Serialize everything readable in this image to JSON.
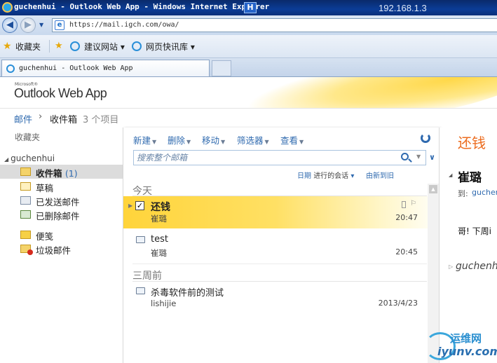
{
  "window": {
    "title": "guchenhui - Outlook Web App - Windows Internet Explorer",
    "badge": "H",
    "ip_address": "192.168.1.3"
  },
  "address_bar": {
    "url": "https://mail.igch.com/owa/"
  },
  "favorites_bar": {
    "favorites_label": "收藏夹",
    "suggested_sites": "建议网站",
    "web_slice_gallery": "网页快讯库"
  },
  "tab": {
    "title": "guchenhui - Outlook Web App"
  },
  "owa": {
    "microsoft_label": "Microsoft®",
    "logo": "Outlook Web App"
  },
  "breadcrumb": {
    "mail": "邮件",
    "separator": "›",
    "inbox": "收件箱",
    "item_count": "3 个项目"
  },
  "folder_pane": {
    "favorites": "收藏夹",
    "account": "guchenhui",
    "folders": [
      {
        "label": "收件箱",
        "count": "(1)",
        "icon": "inbox-icon"
      },
      {
        "label": "草稿",
        "count": "",
        "icon": "drafts-icon"
      },
      {
        "label": "已发送邮件",
        "count": "",
        "icon": "sent-items-icon"
      },
      {
        "label": "已删除邮件",
        "count": "",
        "icon": "deleted-items-icon"
      },
      {
        "label": "便笺",
        "count": "",
        "icon": "notes-icon"
      },
      {
        "label": "垃圾邮件",
        "count": "",
        "icon": "junk-mail-icon"
      }
    ]
  },
  "toolbar": {
    "new": "新建",
    "delete": "删除",
    "move": "移动",
    "filter": "筛选器",
    "view": "查看"
  },
  "search": {
    "placeholder": "搜索整个邮箱"
  },
  "sort": {
    "date": "日期",
    "conversation": "进行的会话",
    "order": "由新到旧"
  },
  "message_list": {
    "groups": [
      {
        "header": "今天",
        "items": [
          {
            "subject": "还钱",
            "sender": "崔璐",
            "time": "20:47",
            "selected": true
          },
          {
            "subject": "test",
            "sender": "崔璐",
            "time": "20:45",
            "selected": false
          }
        ]
      },
      {
        "header": "三周前",
        "items": [
          {
            "subject": "杀毒软件前的测试",
            "sender": "lishijie",
            "time": "2013/4/23",
            "selected": false
          }
        ]
      }
    ]
  },
  "reading_pane": {
    "subject": "还钱",
    "from": "崔璐",
    "to_label": "到:",
    "to_value": "gucher",
    "body": "哥! 下周i",
    "thread": "guchenh"
  },
  "watermark": {
    "text_cn": "运维网",
    "text_url": "iyunv.com"
  },
  "colors": {
    "accent_blue": "#2f6aaf",
    "subject_orange": "#ec6c1f",
    "selected_yellow": "#ffd43a"
  }
}
